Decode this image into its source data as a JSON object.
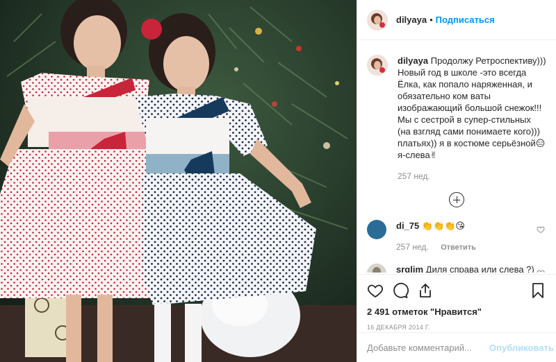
{
  "header": {
    "username": "dilyaya",
    "separator": "•",
    "follow_label": "Подписаться"
  },
  "caption": {
    "username": "dilyaya",
    "text": "Продолжу Ретроспективу))) Новый год в школе -это всегда Ёлка, как попало наряженная, и обязательно ком ваты изображающий большой снежок!!! Мы с сестрой в супер-стильных (на взгляд сами понимаете кого))) платьях)) я в костюме серьёзной😑 я-слева✌",
    "age": "257 нед."
  },
  "comments": [
    {
      "username": "di_75",
      "text": "👏👏👏😘",
      "age": "257 нед.",
      "reply_label": "Ответить"
    },
    {
      "username": "srglim",
      "text": "Диля справа или слева ?) ლ(ಠ益ಠლ)"
    }
  ],
  "actions": {
    "icons": [
      "heart-icon",
      "comment-icon",
      "share-icon",
      "bookmark-icon"
    ]
  },
  "likes_text": "2 491 отметок \"Нравится\"",
  "date_text": "16 декабря 2014 г.",
  "add_comment": {
    "placeholder": "Добавьте комментарий...",
    "publish_label": "Опубликовать"
  },
  "colors": {
    "accent": "#0095f6",
    "publish_disabled": "#b2dffc",
    "muted": "#8e8e8e"
  }
}
